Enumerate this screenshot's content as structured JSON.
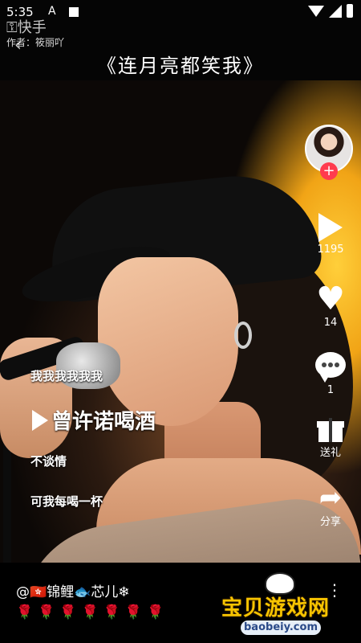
{
  "status_bar": {
    "time": "5:35",
    "indicator": "A"
  },
  "header": {
    "app_name": "快手",
    "author": "作者：筱丽吖",
    "song_title": "《连月亮都笑我》"
  },
  "right_rail": {
    "play_count": "1195",
    "like_count": "14",
    "comment_count": "1",
    "gift_label": "送礼",
    "share_label": "分享"
  },
  "lyrics": {
    "line1": "我我我我我我",
    "current": "曾许诺喝酒",
    "line3": "不谈情",
    "line4": "可我每喝一杯"
  },
  "bottom": {
    "username": "@🇭🇰锦鲤🐟芯儿❄",
    "roses": "🌹🌹🌹🌹🌹🌹🌹",
    "more": "⋮"
  },
  "watermark": {
    "title": "宝贝游戏网",
    "url": "baobeiy.com"
  },
  "colors": {
    "follow": "#ff3b4e",
    "watermark_gold": "#f7c400"
  },
  "icons": [
    "back-icon",
    "play-icon",
    "heart-icon",
    "comment-icon",
    "gift-icon",
    "share-icon",
    "follow-plus-icon"
  ]
}
